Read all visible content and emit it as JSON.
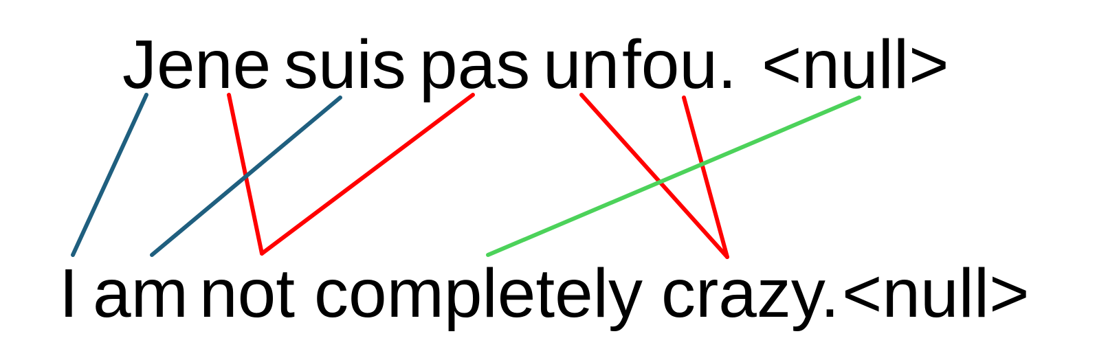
{
  "source": {
    "tokens": [
      "Je",
      "ne",
      "suis",
      "pas",
      "un",
      "fou.",
      "<null>"
    ]
  },
  "target": {
    "tokens": [
      "I",
      "am",
      "not",
      "completely",
      "crazy.",
      "<null>"
    ]
  },
  "colors": {
    "text": "#000000",
    "aligned": "#1f5f7f",
    "mismatch": "#ff0000",
    "null": "#4cd25a"
  },
  "alignments": [
    {
      "source": 0,
      "target": 0,
      "kind": "aligned"
    },
    {
      "source": 1,
      "target": 2,
      "kind": "mismatch"
    },
    {
      "source": 2,
      "target": 1,
      "kind": "aligned"
    },
    {
      "source": 3,
      "target": 2,
      "kind": "mismatch"
    },
    {
      "source": 4,
      "target": 4,
      "kind": "mismatch"
    },
    {
      "source": 5,
      "target": 4,
      "kind": "mismatch"
    },
    {
      "source": 6,
      "target": 3,
      "kind": "null"
    }
  ]
}
